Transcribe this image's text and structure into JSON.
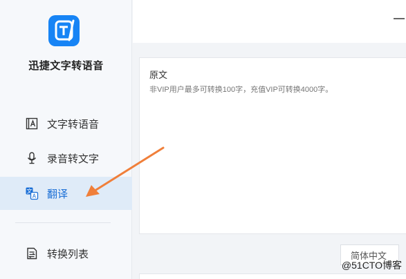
{
  "app": {
    "name": "迅捷文字转语音",
    "logo_icon": "app-logo-icon",
    "brand_color": "#1784f5"
  },
  "sidebar": {
    "items": [
      {
        "label": "文字转语音",
        "icon": "text-document-icon",
        "active": false
      },
      {
        "label": "录音转文字",
        "icon": "microphone-icon",
        "active": false
      },
      {
        "label": "翻译",
        "icon": "translate-icon",
        "active": true
      },
      {
        "label": "转换列表",
        "icon": "list-icon",
        "active": false
      }
    ],
    "active_color": "#1b6fd6"
  },
  "main": {
    "source_title": "原文",
    "source_placeholder": "非VIP用户最多可转换100字，充值VIP可转换4000字。",
    "target_language": "简体中文"
  },
  "annotation": {
    "arrow_color": "#f07f3a"
  },
  "watermark": "@51CTO博客"
}
